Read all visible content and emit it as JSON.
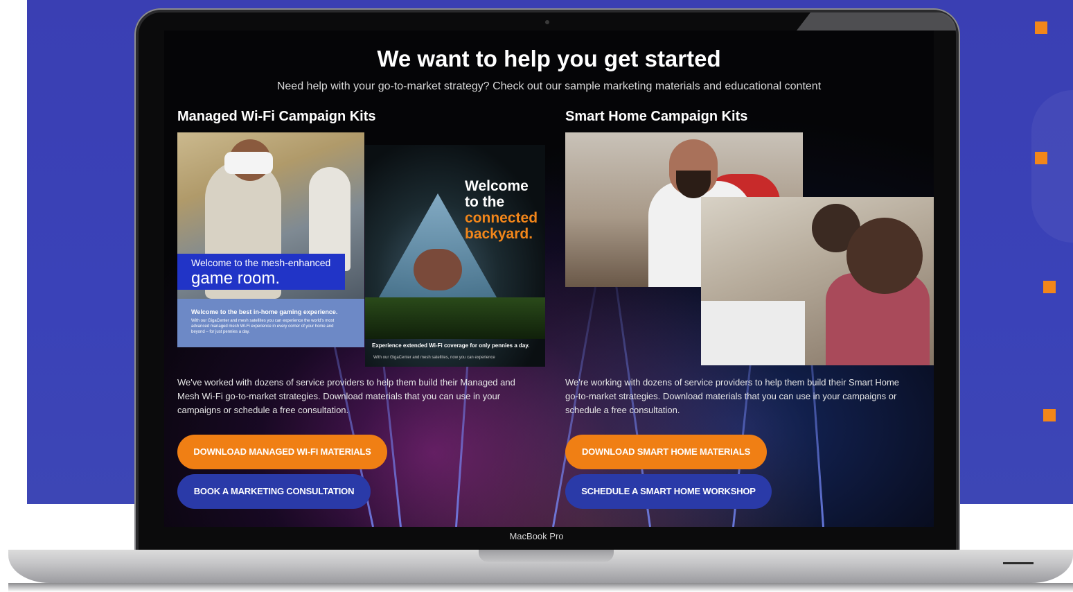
{
  "screen": {
    "title": "We want to help you get started",
    "subtitle": "Need help with your go-to-market strategy? Check out our sample marketing materials and educational content"
  },
  "wifi": {
    "heading": "Managed Wi-Fi Campaign Kits",
    "vr_banner_small": "Welcome to the mesh-enhanced",
    "vr_banner_large": "game room.",
    "vr_info_heading": "Welcome to the best in-home gaming experience.",
    "vr_info_body": "With our GigaCenter and mesh satellites you can experience the world's most advanced managed mesh Wi-Fi experience in every corner of your home and beyond – for just pennies a day.",
    "backyard_line1": "Welcome",
    "backyard_line2": "to the",
    "backyard_line3": "connected",
    "backyard_line4": "backyard.",
    "backyard_caption": "Experience extended Wi-Fi coverage for only pennies a day.",
    "backyard_caption_body": "With our GigaCenter and mesh satellites, now you can experience",
    "paragraph": "We've worked with dozens of service providers to help them build their Managed and Mesh Wi-Fi go-to-market strategies. Download materials that you can use in your campaigns or schedule a free consultation.",
    "download_button": "DOWNLOAD MANAGED WI-FI MATERIALS",
    "consult_button": "BOOK A MARKETING CONSULTATION"
  },
  "smarthome": {
    "heading": "Smart Home Campaign Kits",
    "paragraph": "We're working with dozens of service providers to help them build their Smart Home go-to-market strategies. Download materials that you can use in your campaigns or schedule a free consultation.",
    "download_button": "DOWNLOAD SMART HOME MATERIALS",
    "workshop_button": "SCHEDULE A SMART HOME WORKSHOP"
  },
  "device_label": "MacBook Pro",
  "colors": {
    "background_blue": "#3a3fb3",
    "accent_orange": "#f07f14",
    "button_blue": "#2a3aa8"
  }
}
